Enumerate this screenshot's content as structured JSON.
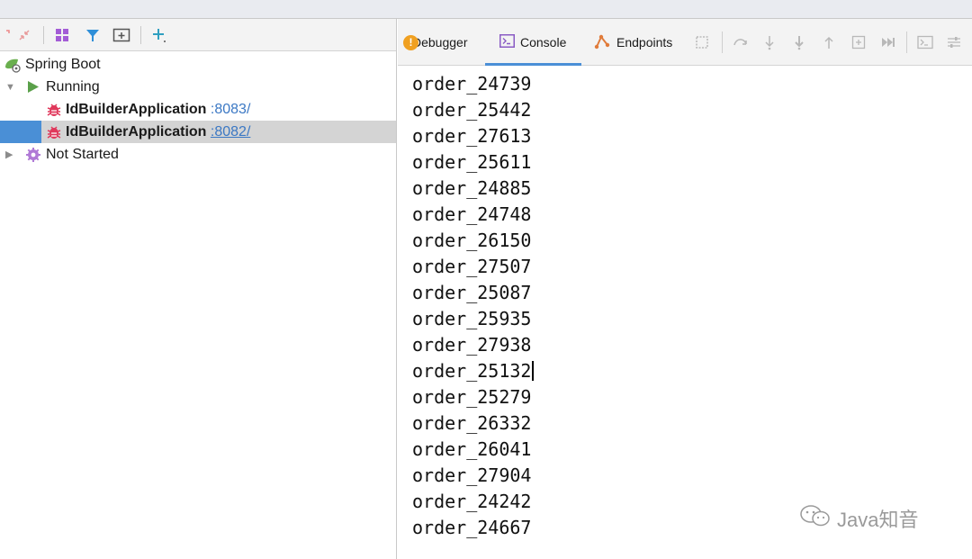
{
  "left_tree": {
    "root": {
      "label": "Spring Boot"
    },
    "running": {
      "label": "Running"
    },
    "apps": [
      {
        "name": "IdBuilderApplication",
        "port": ":8083/"
      },
      {
        "name": "IdBuilderApplication",
        "port": ":8082/"
      }
    ],
    "not_started": {
      "label": "Not Started"
    }
  },
  "right_tabs": {
    "debugger": "Debugger",
    "console": "Console",
    "endpoints": "Endpoints"
  },
  "console_lines": [
    "order_24739",
    "order_25442",
    "order_27613",
    "order_25611",
    "order_24885",
    "order_24748",
    "order_26150",
    "order_27507",
    "order_25087",
    "order_25935",
    "order_27938",
    "order_25132",
    "order_25279",
    "order_26332",
    "order_26041",
    "order_27904",
    "order_24242",
    "order_24667"
  ],
  "watermark": {
    "text": "Java知音"
  },
  "colors": {
    "selection_accent": "#4a8fd6",
    "selected_row": "#d4d4d4",
    "run_green": "#5aa04a",
    "bug_red": "#e0385b",
    "port_link": "#3b78c4"
  }
}
